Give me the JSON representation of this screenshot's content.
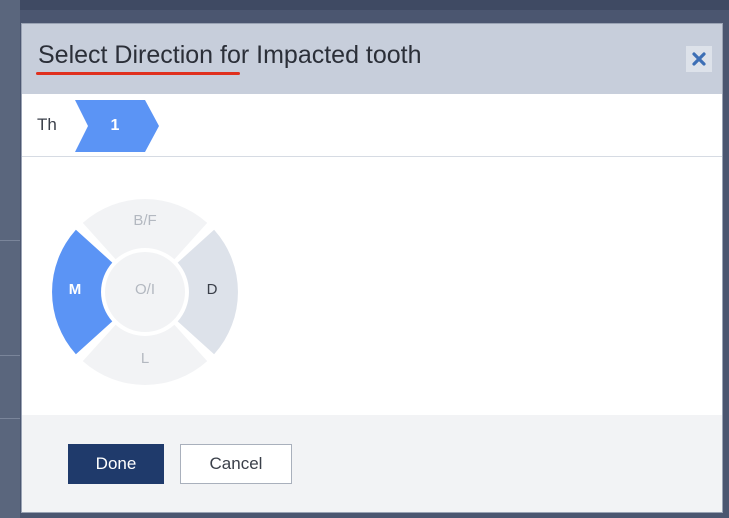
{
  "dialog": {
    "title": "Select Direction for Impacted tooth"
  },
  "header": {
    "close_icon": "close-icon"
  },
  "breadcrumb": {
    "first_label": "Th",
    "active_label": "1"
  },
  "direction_wheel": {
    "top": "B/F",
    "left": "M",
    "right": "D",
    "bottom": "L",
    "center": "O/I",
    "selected": "M"
  },
  "footer": {
    "done_label": "Done",
    "cancel_label": "Cancel"
  },
  "colors": {
    "header_bg": "#c7cedb",
    "accent_blue": "#5b94f5",
    "done_bg": "#1f3a6b",
    "title_underline": "#e0301e"
  }
}
